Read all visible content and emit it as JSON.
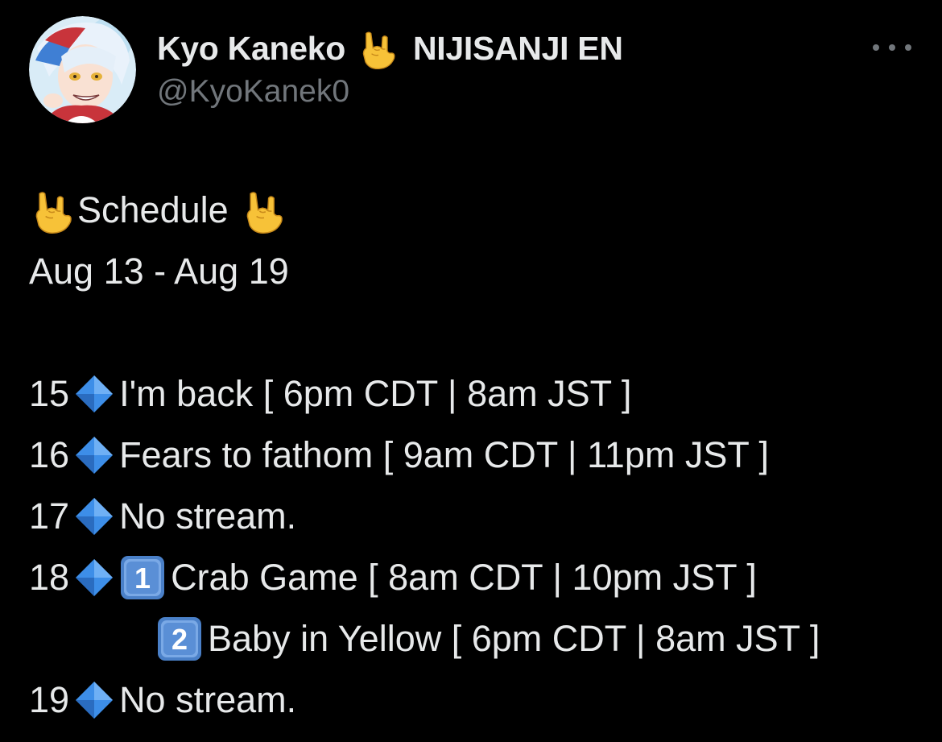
{
  "author": {
    "display_name": "Kyo Kaneko",
    "affiliation": "NIJISANJI EN",
    "handle": "@KyoKanek0",
    "name_emoji": "sign-of-horns-icon",
    "avatar": "avatar-illustration"
  },
  "more_button": "more-options-icon",
  "tweet": {
    "title_emoji": "sign-of-horns-icon",
    "title": "Schedule",
    "date_range": "Aug 13 - Aug 19",
    "schedule": [
      {
        "day": "15",
        "text": "I'm back [ 6pm CDT | 8am JST ]"
      },
      {
        "day": "16",
        "text": "Fears to fathom [ 9am CDT | 11pm JST ]"
      },
      {
        "day": "17",
        "text": "No stream."
      },
      {
        "day": "18",
        "keycap": "1",
        "text": "Crab Game [ 8am CDT | 10pm JST ]"
      },
      {
        "day": "",
        "keycap": "2",
        "text": "Baby in Yellow [ 6pm CDT | 8am JST ]"
      },
      {
        "day": "19",
        "text": "No stream."
      }
    ]
  },
  "colors": {
    "background": "#000000",
    "text": "#e7e9ea",
    "secondary_text": "#71767b",
    "diamond": "#3d8ee8",
    "keycap": "#5a8fd6",
    "emoji_yellow": "#f7c238"
  }
}
